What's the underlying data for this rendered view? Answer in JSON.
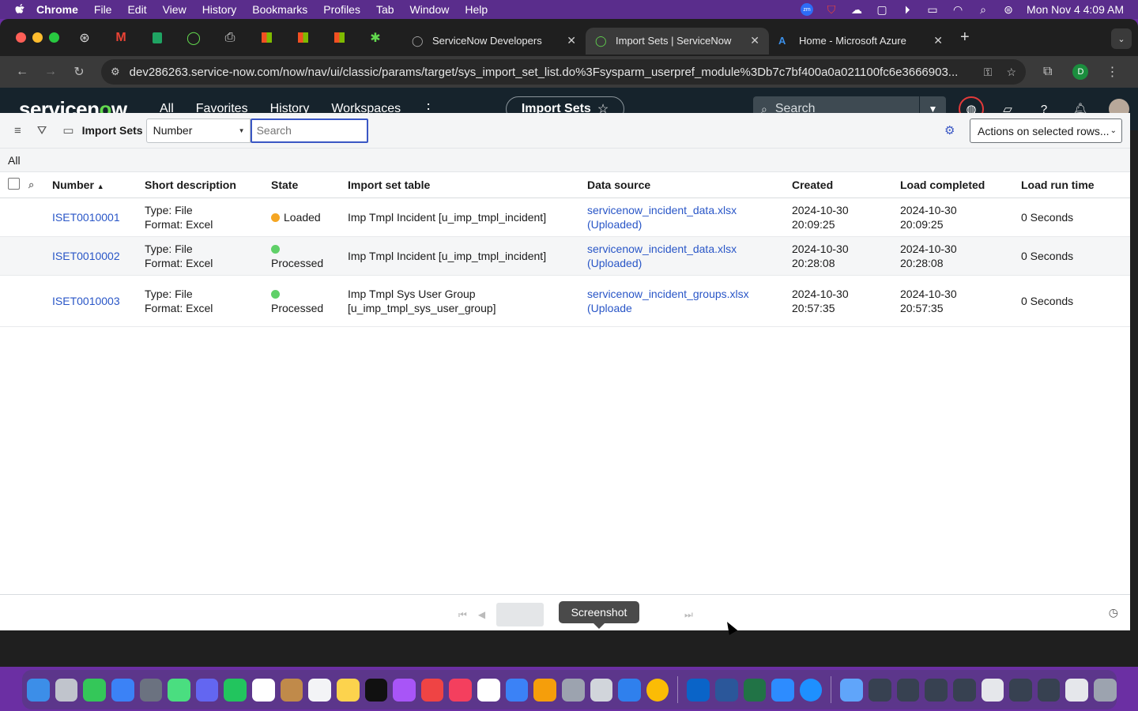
{
  "menubar": {
    "items": [
      "Chrome",
      "File",
      "Edit",
      "View",
      "History",
      "Bookmarks",
      "Profiles",
      "Tab",
      "Window",
      "Help"
    ],
    "clock": "Mon Nov 4  4:09 AM"
  },
  "browser": {
    "tabs": [
      {
        "title": "ServiceNow Developers",
        "active": false
      },
      {
        "title": "Import Sets | ServiceNow",
        "active": true
      },
      {
        "title": "Home - Microsoft Azure",
        "active": false
      }
    ],
    "url": "dev286263.service-now.com/now/nav/ui/classic/params/target/sys_import_set_list.do%3Fsysparm_userpref_module%3Db7c7bf400a0a021100fc6e3666903...",
    "profile_initial": "D"
  },
  "sn_header": {
    "logo_pre": "servicen",
    "logo_o": "o",
    "logo_post": "w",
    "nav": [
      "All",
      "Favorites",
      "History",
      "Workspaces"
    ],
    "more": "⋮",
    "context_pill": "Import Sets",
    "search_placeholder": "Search"
  },
  "list": {
    "title": "Import Sets",
    "field_select": "Number",
    "search_placeholder": "Search",
    "actions_label": "Actions on selected rows...",
    "breadcrumb": "All",
    "columns": [
      "Number",
      "Short description",
      "State",
      "Import set table",
      "Data source",
      "Created",
      "Load completed",
      "Load run time"
    ],
    "rows": [
      {
        "number": "ISET0010001",
        "desc_1": "Type: File",
        "desc_2": "Format: Excel",
        "state": "Loaded",
        "state_color": "#f5a623",
        "table_1": "Imp Tmpl Incident [u_imp_tmpl_incident]",
        "table_2": "",
        "source_1": "servicenow_incident_data.xlsx",
        "source_2": "(Uploaded)",
        "created_1": "2024-10-30",
        "created_2": "20:09:25",
        "completed_1": "2024-10-30",
        "completed_2": "20:09:25",
        "runtime": "0 Seconds"
      },
      {
        "number": "ISET0010002",
        "desc_1": "Type: File",
        "desc_2": "Format: Excel",
        "state": "Processed",
        "state_color": "#5fd068",
        "table_1": "Imp Tmpl Incident [u_imp_tmpl_incident]",
        "table_2": "",
        "source_1": "servicenow_incident_data.xlsx",
        "source_2": "(Uploaded)",
        "created_1": "2024-10-30",
        "created_2": "20:28:08",
        "completed_1": "2024-10-30",
        "completed_2": "20:28:08",
        "runtime": "0 Seconds"
      },
      {
        "number": "ISET0010003",
        "desc_1": "Type: File",
        "desc_2": "Format: Excel",
        "state": "Processed",
        "state_color": "#5fd068",
        "table_1": "Imp Tmpl Sys User Group",
        "table_2": "[u_imp_tmpl_sys_user_group]",
        "source_1": "servicenow_incident_groups.xlsx",
        "source_2": "(Uploade",
        "created_1": "2024-10-30",
        "created_2": "20:57:35",
        "completed_1": "2024-10-30",
        "completed_2": "20:57:35",
        "runtime": "0 Seconds"
      }
    ]
  },
  "footer": {
    "tooltip": "Screenshot"
  }
}
